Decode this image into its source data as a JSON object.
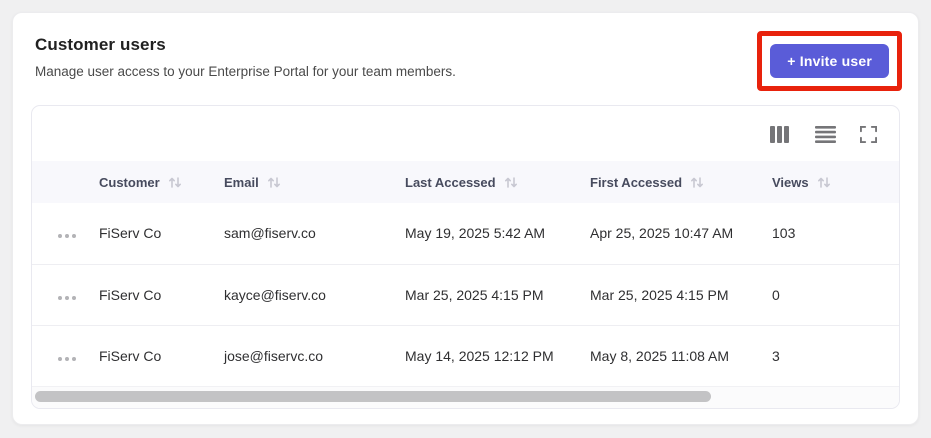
{
  "header": {
    "title": "Customer users",
    "subtitle": "Manage user access to your Enterprise Portal for your team members.",
    "invite_button_label": "+ Invite user"
  },
  "toolbar": {
    "icons": [
      "columns-icon",
      "row-density-icon",
      "fullscreen-icon"
    ]
  },
  "table": {
    "columns": [
      "Customer",
      "Email",
      "Last Accessed",
      "First Accessed",
      "Views"
    ],
    "sortable": true,
    "rows": [
      {
        "customer": "FiServ Co",
        "email": "sam@fiserv.co",
        "last_accessed": "May 19, 2025 5:42 AM",
        "first_accessed": "Apr 25, 2025 10:47 AM",
        "views": "103"
      },
      {
        "customer": "FiServ Co",
        "email": "kayce@fiserv.co",
        "last_accessed": "Mar 25, 2025 4:15 PM",
        "first_accessed": "Mar 25, 2025 4:15 PM",
        "views": "0"
      },
      {
        "customer": "FiServ Co",
        "email": "jose@fiservc.co",
        "last_accessed": "May 14, 2025 12:12 PM",
        "first_accessed": "May 8, 2025 11:08 AM",
        "views": "3"
      }
    ]
  },
  "scrollbar": {
    "thumb_fraction": 0.78
  },
  "colors": {
    "accent_button": "#5a5cd8",
    "highlight_border": "#e8220c",
    "header_row_bg": "#f8f8fc",
    "page_bg": "#f0f0f1"
  }
}
